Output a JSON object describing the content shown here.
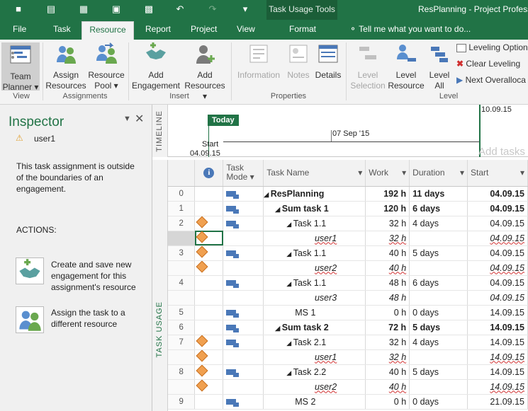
{
  "qat": {
    "save_icon": "save-icon",
    "undo_icon": "undo-icon",
    "redo_icon": "redo-icon"
  },
  "titlebar": {
    "context_header": "Task Usage Tools",
    "app_title": "ResPlanning - Project Profess"
  },
  "tabs": [
    "File",
    "Task",
    "Resource",
    "Report",
    "Project",
    "View",
    "Format"
  ],
  "active_tab": "Resource",
  "tell_me": "Tell me what you want to do...",
  "ribbon": {
    "team_planner": [
      "Team",
      "Planner"
    ],
    "assign_resources": [
      "Assign",
      "Resources"
    ],
    "resource_pool": [
      "Resource",
      "Pool"
    ],
    "add_engagement": [
      "Add",
      "Engagement"
    ],
    "add_resources": [
      "Add",
      "Resources"
    ],
    "information": "Information",
    "notes": "Notes",
    "details": "Details",
    "level_selection": [
      "Level",
      "Selection"
    ],
    "level_resource": [
      "Level",
      "Resource"
    ],
    "level_all": [
      "Level",
      "All"
    ],
    "leveling_options": "Leveling Option",
    "clear_leveling": "Clear Leveling",
    "next_overallocation": "Next Overalloca",
    "groups": {
      "view": "View",
      "assignments": "Assignments",
      "insert": "Insert",
      "properties": "Properties",
      "level": "Level"
    }
  },
  "inspector": {
    "title": "Inspector",
    "subject": "user1",
    "message": [
      "This task assignment is outside",
      "of the boundaries of an",
      "engagement."
    ],
    "actions_label": "ACTIONS:",
    "action1": [
      "Create and save new",
      "engagement for this",
      "assignment's resource"
    ],
    "action2": [
      "Assign the task to a",
      "different resource"
    ]
  },
  "timeline": {
    "label": "TIMELINE",
    "today": "Today",
    "start_label": "Start",
    "start_date": "04.09.15",
    "mid_date": "07 Sep '15",
    "end_date": "10.09.15",
    "add_tasks": "Add tasks"
  },
  "grid_label": "TASK USAGE",
  "columns": {
    "task_mode": [
      "Task",
      "Mode"
    ],
    "task_name": "Task Name",
    "work": "Work",
    "duration": "Duration",
    "start": "Start"
  },
  "rows": [
    {
      "id": "0",
      "ind": false,
      "mode": true,
      "name": "ResPlanning",
      "level": 0,
      "kind": "summary",
      "work": "192 h",
      "dur": "11 days",
      "start": "04.09.15"
    },
    {
      "id": "1",
      "ind": false,
      "mode": true,
      "name": "Sum task 1",
      "level": 1,
      "kind": "summary",
      "work": "120 h",
      "dur": "6 days",
      "start": "04.09.15"
    },
    {
      "id": "2",
      "ind": true,
      "mode": true,
      "name": "Task 1.1",
      "level": 2,
      "kind": "task",
      "work": "32 h",
      "dur": "4 days",
      "start": "04.09.15"
    },
    {
      "id": "",
      "ind": true,
      "mode": false,
      "name": "user1",
      "level": 3,
      "kind": "assign",
      "work": "32 h",
      "dur": "",
      "start": "04.09.15",
      "selected": true
    },
    {
      "id": "3",
      "ind": true,
      "mode": true,
      "name": "Task 1.1",
      "level": 2,
      "kind": "task",
      "work": "40 h",
      "dur": "5 days",
      "start": "04.09.15"
    },
    {
      "id": "",
      "ind": true,
      "mode": false,
      "name": "user2",
      "level": 3,
      "kind": "assign",
      "work": "40 h",
      "dur": "",
      "start": "04.09.15"
    },
    {
      "id": "4",
      "ind": false,
      "mode": true,
      "name": "Task 1.1",
      "level": 2,
      "kind": "task",
      "work": "48 h",
      "dur": "6 days",
      "start": "04.09.15"
    },
    {
      "id": "",
      "ind": false,
      "mode": false,
      "name": "user3",
      "level": 3,
      "kind": "assignplain",
      "work": "48 h",
      "dur": "",
      "start": "04.09.15"
    },
    {
      "id": "5",
      "ind": false,
      "mode": true,
      "name": "MS 1",
      "level": 2.5,
      "kind": "ms",
      "work": "0 h",
      "dur": "0 days",
      "start": "14.09.15"
    },
    {
      "id": "6",
      "ind": false,
      "mode": true,
      "name": "Sum task 2",
      "level": 1,
      "kind": "summary",
      "work": "72 h",
      "dur": "5 days",
      "start": "14.09.15"
    },
    {
      "id": "7",
      "ind": true,
      "mode": true,
      "name": "Task 2.1",
      "level": 2,
      "kind": "task",
      "work": "32 h",
      "dur": "4 days",
      "start": "14.09.15"
    },
    {
      "id": "",
      "ind": true,
      "mode": false,
      "name": "user1",
      "level": 3,
      "kind": "assign",
      "work": "32 h",
      "dur": "",
      "start": "14.09.15"
    },
    {
      "id": "8",
      "ind": true,
      "mode": true,
      "name": "Task 2.2",
      "level": 2,
      "kind": "task",
      "work": "40 h",
      "dur": "5 days",
      "start": "14.09.15"
    },
    {
      "id": "",
      "ind": true,
      "mode": false,
      "name": "user2",
      "level": 3,
      "kind": "assign",
      "work": "40 h",
      "dur": "",
      "start": "14.09.15"
    },
    {
      "id": "9",
      "ind": false,
      "mode": true,
      "name": "MS 2",
      "level": 2.5,
      "kind": "ms",
      "work": "0 h",
      "dur": "0 days",
      "start": "21.09.15"
    }
  ]
}
